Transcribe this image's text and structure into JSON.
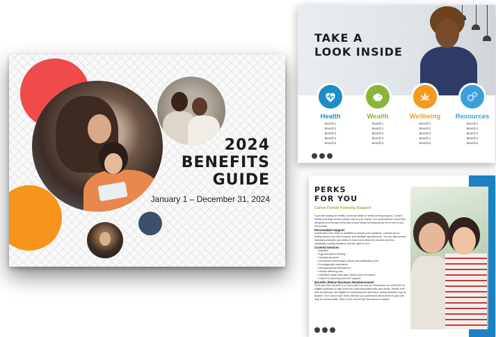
{
  "cover": {
    "title_line1": "2024",
    "title_line2": "BENEFITS",
    "title_line3": "GUIDE",
    "date_range": "January 1 – December 31, 2024"
  },
  "inside": {
    "title_line1": "TAKE A",
    "title_line2": "LOOK INSIDE",
    "categories": [
      {
        "label": "Health",
        "color": "#1b8ec9",
        "icon": "heart-pulse-icon",
        "items": [
          "Benefit 1",
          "Benefit 2",
          "Benefit 3",
          "Benefit 4",
          "Benefit 5"
        ]
      },
      {
        "label": "Wealth",
        "color": "#8ab43b",
        "icon": "piggy-bank-icon",
        "items": [
          "Benefit 1",
          "Benefit 2",
          "Benefit 3",
          "Benefit 4",
          "Benefit 5"
        ]
      },
      {
        "label": "Wellbeing",
        "color": "#f39a1f",
        "icon": "lotus-icon",
        "items": [
          "Benefit 1",
          "Benefit 2",
          "Benefit 3",
          "Benefit 4",
          "Benefit 5"
        ]
      },
      {
        "label": "Resources",
        "color": "#3aa0dc",
        "icon": "gears-icon",
        "items": [
          "Benefit 1",
          "Benefit 2",
          "Benefit 3",
          "Benefit 4",
          "Benefit 5"
        ]
      }
    ]
  },
  "perks": {
    "title_line1": "PERKS",
    "title_line2": "FOR YOU",
    "subtitle": "Carrot Family Forming Support",
    "intro": "If you are looking for fertility, hormonal health or family-forming support, Carrot's fertility concierge service options that fit your needs. Your personalized Carrot Plan will guide you through every step of your family forming journey at no cost to you. We include:",
    "section1_heading": "Personalized Support",
    "section1_text": "A dedicated Care Team is available to answer your questions, connect you to fertility doctors and other experts, and facilitate appointments. You can also access educational articles and videos to learn more about the process and find candidates making decisions that are right for you.",
    "section2_heading": "Covered Services",
    "covered": [
      "Adoption",
      "Egg and sperm freezing",
      "Gestational carrier",
      "Intrauterine insemination (IUI)/In vitro fertilization (IVF)",
      "Pre-diagnostic exploration",
      "Menopause/low testosterone",
      "Gender affirming care",
      "Unlimited virtual visits with Carrot's team of experts",
      "Carrot Rx pharmacy and 24/7 support"
    ],
    "section3_heading": "$10,000 Lifetime Maximum Reimbursement",
    "section3_text": "Once you have enrolled in a Carrot plan you may be reimbursed up to $10,000 for eligible expenses to help cover the costs associated with your needs. Please note that all expenses are eligible for reimbursement and some reimbursements may be taxable. Your Carrot Care Team will help you understand which items in your plan may be reimbursable. Refer to the Carrot Plan Document for details."
  },
  "colors": {
    "red_circle": "#ef4b4b",
    "orange_circle": "#f7941d",
    "navy_circle": "#3e4f6b",
    "perks_blue": "#1e7fc1",
    "perks_green": "#8ab43b"
  }
}
